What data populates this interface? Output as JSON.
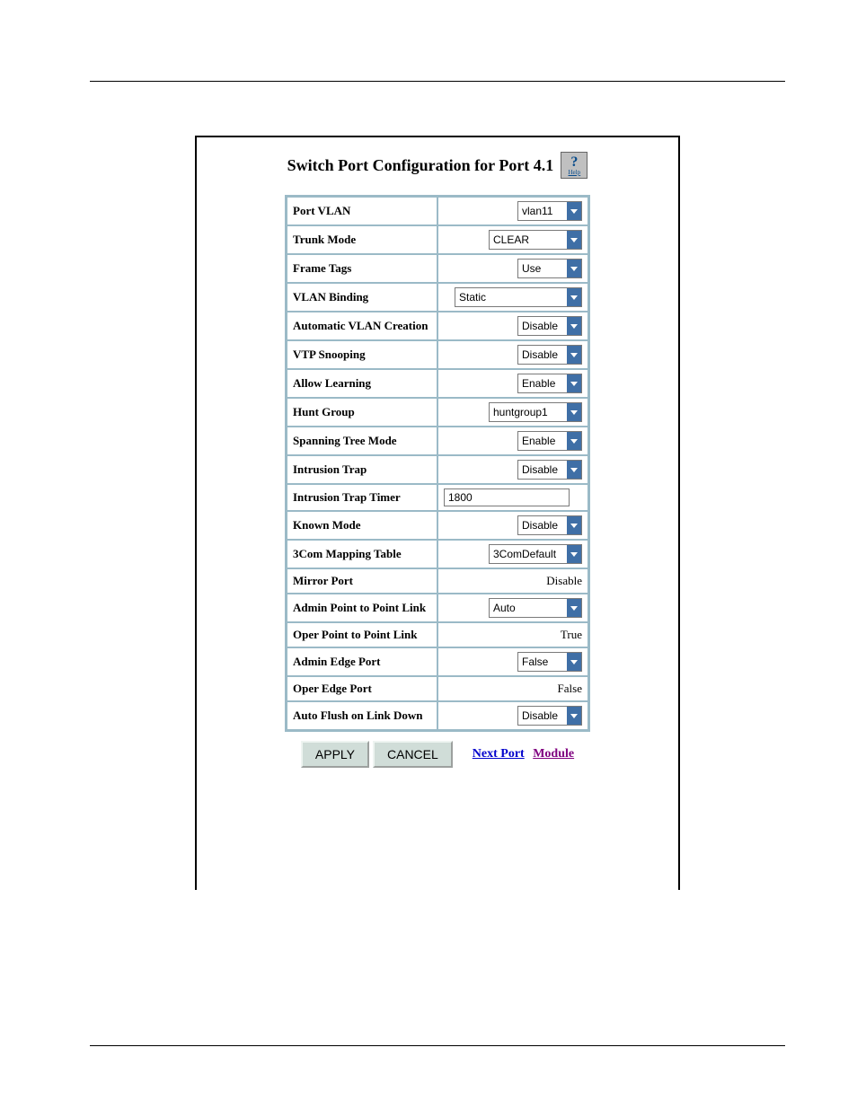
{
  "title": "Switch Port Configuration for Port 4.1",
  "help": {
    "glyph": "?",
    "label": "Help"
  },
  "rows": [
    {
      "label": "Port VLAN",
      "kind": "select",
      "value": "vlan11",
      "width": "narrow"
    },
    {
      "label": "Trunk Mode",
      "kind": "select",
      "value": "CLEAR",
      "width": "med"
    },
    {
      "label": "Frame Tags",
      "kind": "select",
      "value": "Use",
      "width": "narrow"
    },
    {
      "label": "VLAN Binding",
      "kind": "select",
      "value": "Static",
      "width": "wide"
    },
    {
      "label": "Automatic VLAN Creation",
      "kind": "select",
      "value": "Disable",
      "width": "narrow"
    },
    {
      "label": "VTP Snooping",
      "kind": "select",
      "value": "Disable",
      "width": "narrow"
    },
    {
      "label": "Allow Learning",
      "kind": "select",
      "value": "Enable",
      "width": "narrow"
    },
    {
      "label": "Hunt Group",
      "kind": "select",
      "value": "huntgroup1",
      "width": "med"
    },
    {
      "label": "Spanning Tree Mode",
      "kind": "select",
      "value": "Enable",
      "width": "narrow"
    },
    {
      "label": "Intrusion Trap",
      "kind": "select",
      "value": "Disable",
      "width": "narrow"
    },
    {
      "label": "Intrusion Trap Timer",
      "kind": "input",
      "value": "1800"
    },
    {
      "label": "Known Mode",
      "kind": "select",
      "value": "Disable",
      "width": "narrow"
    },
    {
      "label": "3Com Mapping Table",
      "kind": "select",
      "value": "3ComDefault",
      "width": "med"
    },
    {
      "label": "Mirror Port",
      "kind": "static",
      "value": "Disable"
    },
    {
      "label": "Admin Point to Point Link",
      "kind": "select",
      "value": "Auto",
      "width": "med"
    },
    {
      "label": "Oper Point to Point Link",
      "kind": "static",
      "value": "True"
    },
    {
      "label": "Admin Edge Port",
      "kind": "select",
      "value": "False",
      "width": "narrow"
    },
    {
      "label": "Oper Edge Port",
      "kind": "static",
      "value": "False"
    },
    {
      "label": "Auto Flush on Link Down",
      "kind": "select",
      "value": "Disable",
      "width": "narrow"
    }
  ],
  "buttons": {
    "apply": "APPLY",
    "cancel": "CANCEL"
  },
  "links": {
    "next": "Next Port",
    "module": "Module"
  }
}
